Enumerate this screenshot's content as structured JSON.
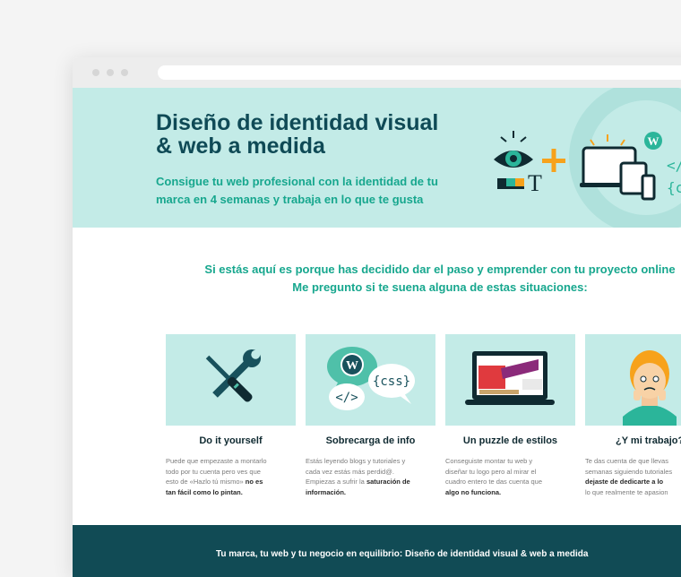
{
  "hero": {
    "title_line1": "Diseño de identidad visual",
    "title_line2": "& web a medida",
    "subtitle_line1": "Consigue tu web profesional con la identidad de tu",
    "subtitle_line2": "marca en 4 semanas y trabaja en lo que te gusta",
    "code_tag": "</",
    "css_tag": "{cs"
  },
  "intro": {
    "line1": "Si estás aquí es porque has decidido dar el paso y emprender con tu proyecto online",
    "line2": "Me pregunto si te suena alguna de estas situaciones:"
  },
  "cards": [
    {
      "icon": "tools-icon",
      "title": "Do it yourself",
      "desc_line1": "Puede que empezaste a montarlo",
      "desc_line2": "todo por tu cuenta pero ves que",
      "desc_line3_pre": "esto de «Hazlo tú mismo» ",
      "desc_line3_bold": "no es",
      "desc_line4_bold": "tan fácil como lo pintan."
    },
    {
      "icon": "wordpress-icon",
      "title": "Sobrecarga de info",
      "desc_line1": "Estás leyendo blogs y tutoriales y",
      "desc_line2": "cada vez estás más perdid@.",
      "desc_line3_pre": "Empiezas a sufrir la ",
      "desc_line3_bold": "saturación de",
      "desc_line4_bold": "información.",
      "bubble_css": "{css}",
      "bubble_code": "</>"
    },
    {
      "icon": "laptop-icon",
      "title": "Un puzzle de estilos",
      "desc_line1": "Conseguiste montar tu web y",
      "desc_line2": "diseñar tu logo pero al mirar el",
      "desc_line3_pre": "cuadro entero te das cuenta que",
      "desc_line4_bold": "algo no funciona."
    },
    {
      "icon": "person-icon",
      "title": "¿Y mi trabajo?",
      "desc_line1": "Te das cuenta de que llevas",
      "desc_line2": "semanas siguiendo tutoriales",
      "desc_line3_bold": "dejaste de dedicarte a lo",
      "desc_line4_pre": "lo que realmente te apasion"
    }
  ],
  "footer": {
    "text": "Tu marca, tu web y tu negocio en equilibrio: Diseño de identidad visual & web a medida"
  },
  "colors": {
    "teal_light": "#c3ebe7",
    "teal_dark": "#114b55",
    "accent_green": "#17a78e",
    "accent_orange": "#f7a21b"
  }
}
